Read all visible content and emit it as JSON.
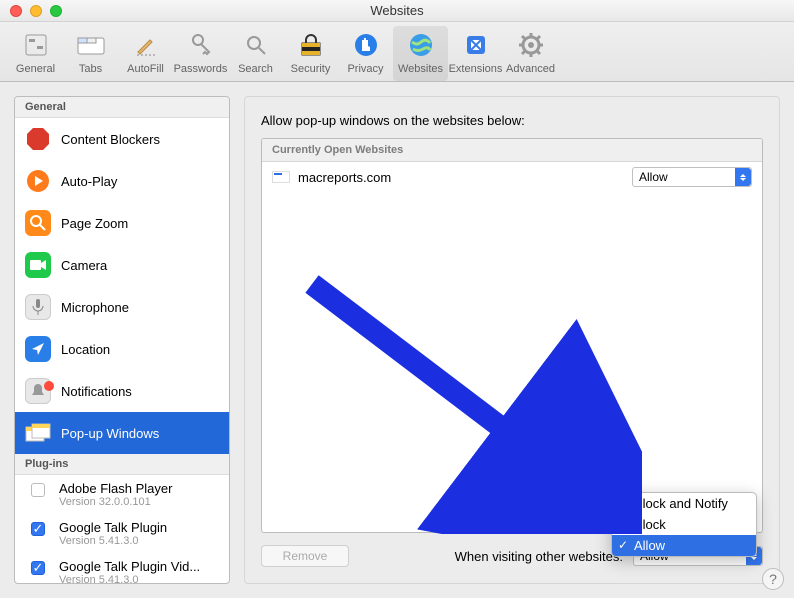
{
  "window": {
    "title": "Websites"
  },
  "toolbar": {
    "items": [
      {
        "label": "General"
      },
      {
        "label": "Tabs"
      },
      {
        "label": "AutoFill"
      },
      {
        "label": "Passwords"
      },
      {
        "label": "Search"
      },
      {
        "label": "Security"
      },
      {
        "label": "Privacy"
      },
      {
        "label": "Websites"
      },
      {
        "label": "Extensions"
      },
      {
        "label": "Advanced"
      }
    ]
  },
  "sidebar": {
    "general_header": "General",
    "items": [
      {
        "label": "Content Blockers"
      },
      {
        "label": "Auto-Play"
      },
      {
        "label": "Page Zoom"
      },
      {
        "label": "Camera"
      },
      {
        "label": "Microphone"
      },
      {
        "label": "Location"
      },
      {
        "label": "Notifications"
      },
      {
        "label": "Pop-up Windows"
      }
    ],
    "plugins_header": "Plug-ins",
    "plugins": [
      {
        "label": "Adobe Flash Player",
        "version": "Version 32.0.0.101"
      },
      {
        "label": "Google Talk Plugin",
        "version": "Version 5.41.3.0"
      },
      {
        "label": "Google Talk Plugin Vid...",
        "version": "Version 5.41.3.0"
      }
    ]
  },
  "panel": {
    "title": "Allow pop-up windows on the websites below:",
    "table_header": "Currently Open Websites",
    "rows": [
      {
        "site": "macreports.com",
        "setting": "Allow"
      }
    ],
    "remove_label": "Remove",
    "footer_label": "When visiting other websites:",
    "footer_setting": "Allow"
  },
  "menu": {
    "options": [
      {
        "label": "Block and Notify"
      },
      {
        "label": "Block"
      },
      {
        "label": "Allow"
      }
    ]
  },
  "help": "?"
}
